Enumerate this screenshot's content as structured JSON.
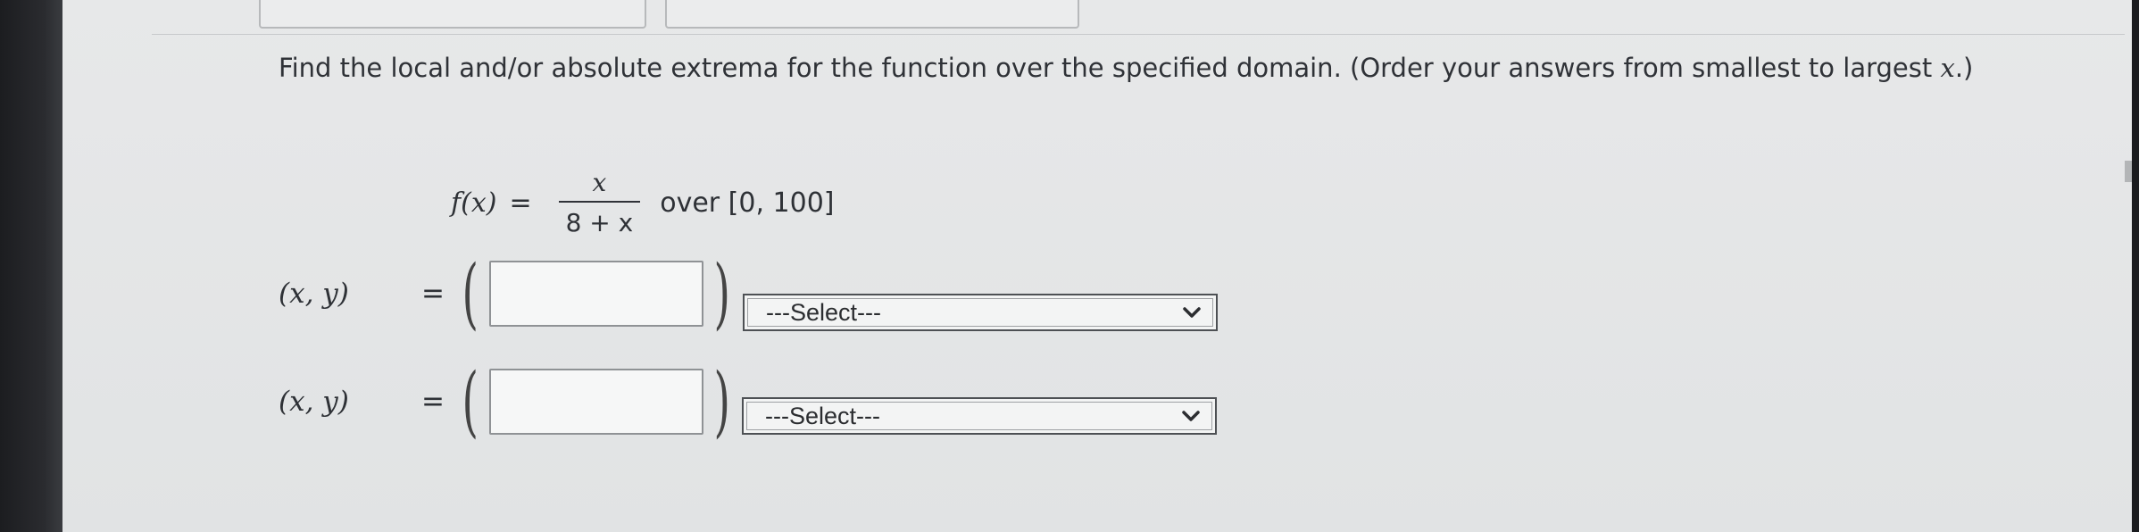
{
  "question": {
    "text_main": "Find the local and/or absolute extrema for the function over the specified domain. (Order your answers from smallest to largest ",
    "text_var": "x",
    "text_end": ".)"
  },
  "function": {
    "lhs_name": "f",
    "lhs_arg": "(x)",
    "equals": "=",
    "numerator": "x",
    "denominator": "8 + x",
    "domain_text": "over [0, 100]"
  },
  "answers": [
    {
      "label": "(x, y)",
      "equals": "=",
      "open_paren": "(",
      "close_paren": ")",
      "input_value": "",
      "select_value": "---Select---"
    },
    {
      "label": "(x, y)",
      "equals": "=",
      "open_paren": "(",
      "close_paren": ")",
      "input_value": "",
      "select_value": "---Select---"
    }
  ],
  "icons": {
    "dropdown": "chevron-down-icon"
  }
}
